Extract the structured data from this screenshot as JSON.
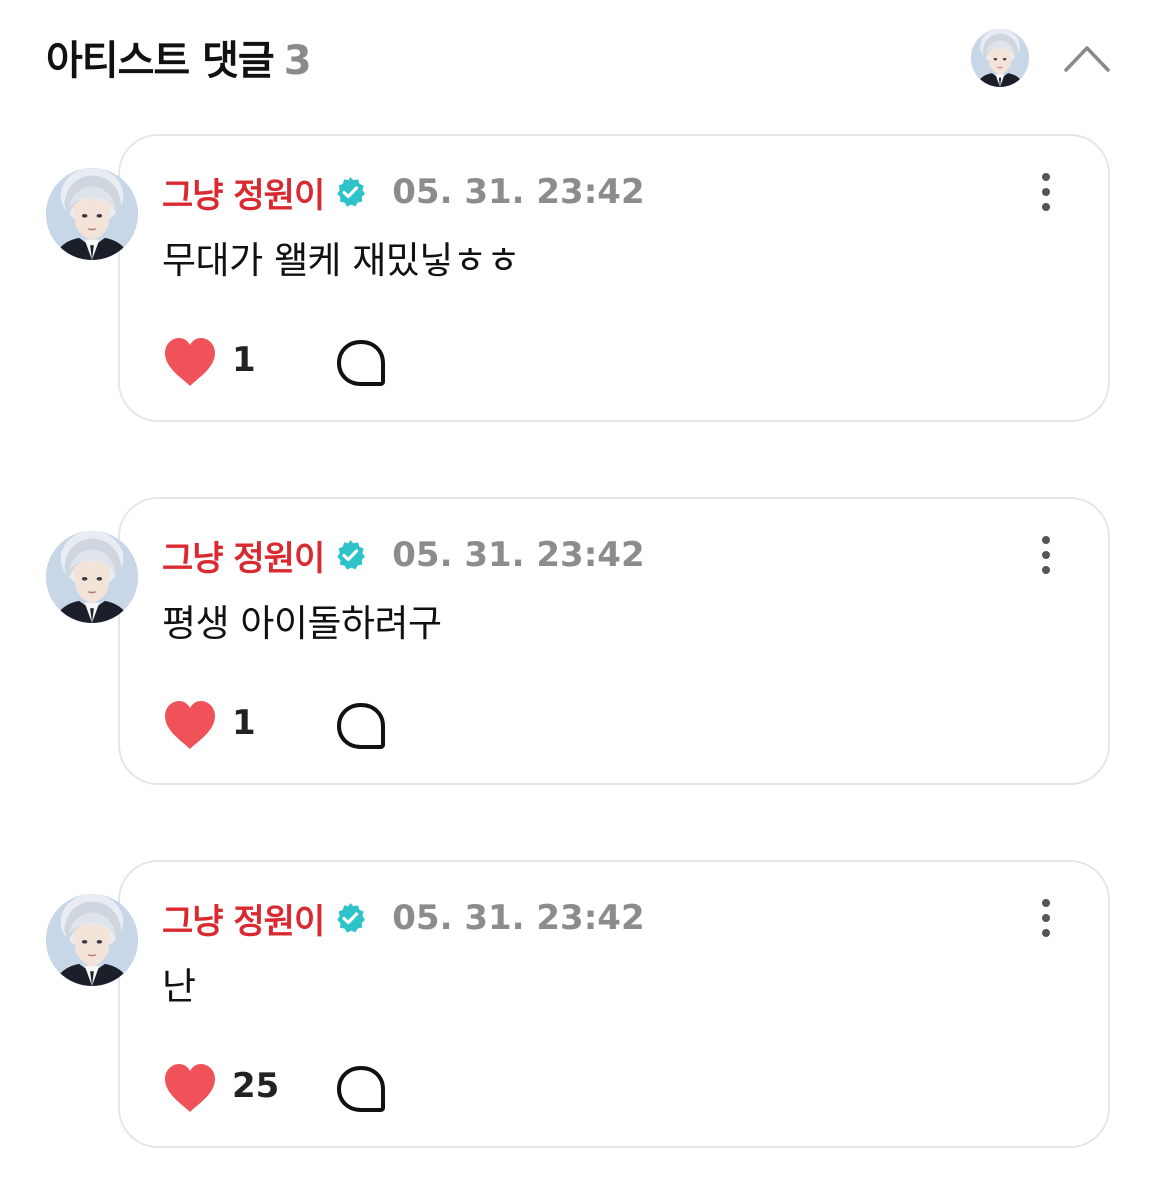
{
  "header": {
    "title": "아티스트 댓글",
    "count": "3",
    "avatar_icon": "artist-avatar",
    "collapse_icon": "chevron-up-icon"
  },
  "colors": {
    "author": "#d92a31",
    "verified": "#2dc3c8",
    "heart": "#f0525a",
    "meta_gray": "#8c8c8c"
  },
  "comments": [
    {
      "author": "그냥 정원이",
      "verified_icon": "verified-badge-icon",
      "time": "05. 31. 23:42",
      "text": "무대가 왤케 재밌닣ㅎㅎ",
      "likes": "1"
    },
    {
      "author": "그냥 정원이",
      "verified_icon": "verified-badge-icon",
      "time": "05. 31. 23:42",
      "text": "평생 아이돌하려구",
      "likes": "1"
    },
    {
      "author": "그냥 정원이",
      "verified_icon": "verified-badge-icon",
      "time": "05. 31. 23:42",
      "text": "난",
      "likes": "25"
    }
  ]
}
